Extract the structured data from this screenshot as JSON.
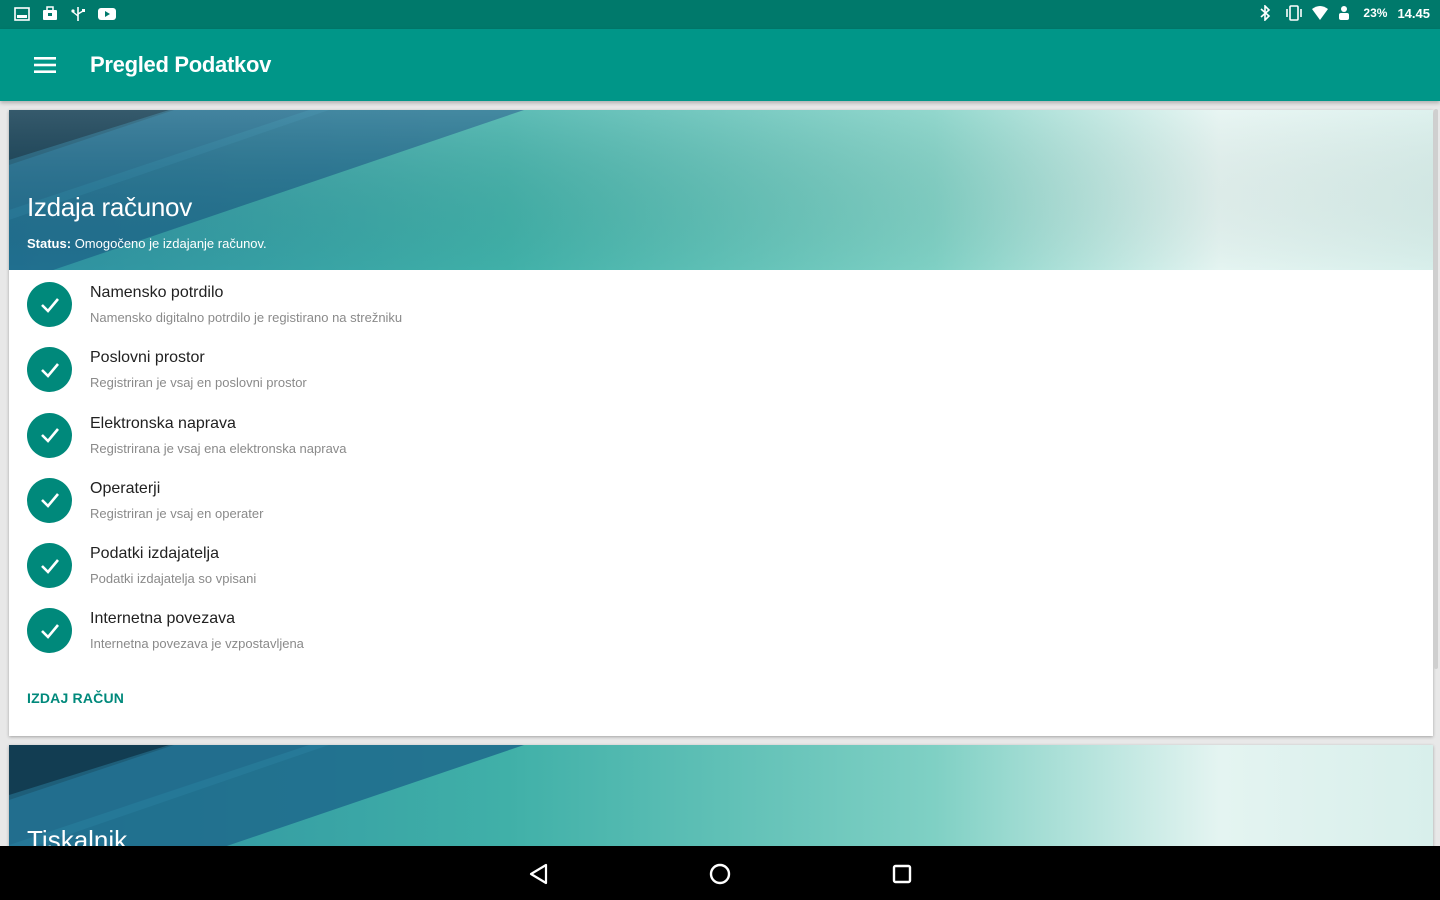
{
  "status_bar": {
    "left_icons": [
      "gallery-icon",
      "briefcase-icon",
      "usb-icon",
      "video-icon"
    ],
    "battery_text": "23%",
    "time": "14.45",
    "right_icons": [
      "bluetooth-icon",
      "vibrate-icon",
      "wifi-icon",
      "person-icon"
    ]
  },
  "app_bar": {
    "title": "Pregled Podatkov",
    "menu_icon": "hamburger-menu-icon"
  },
  "cards": [
    {
      "title": "Izdaja računov",
      "status_label": "Status:",
      "status_text": "Omogočeno je izdajanje računov.",
      "items": [
        {
          "title": "Namensko potrdilo",
          "subtitle": "Namensko digitalno potrdilo je registirano na strežniku"
        },
        {
          "title": "Poslovni prostor",
          "subtitle": "Registriran je vsaj en poslovni prostor"
        },
        {
          "title": "Elektronska naprava",
          "subtitle": "Registrirana je vsaj ena elektronska naprava"
        },
        {
          "title": "Operaterji",
          "subtitle": "Registriran je vsaj en operater"
        },
        {
          "title": "Podatki izdajatelja",
          "subtitle": "Podatki izdajatelja so vpisani"
        },
        {
          "title": "Internetna povezava",
          "subtitle": "Internetna povezava je vzpostavljena"
        }
      ],
      "action_label": "IZDAJ RAČUN"
    },
    {
      "title": "Tiskalnik"
    }
  ],
  "colors": {
    "status_bar": "#00796b",
    "app_bar": "#009688",
    "accent": "#00897b"
  },
  "nav_bar": {
    "buttons": [
      "back-icon",
      "home-icon",
      "recents-icon"
    ]
  }
}
